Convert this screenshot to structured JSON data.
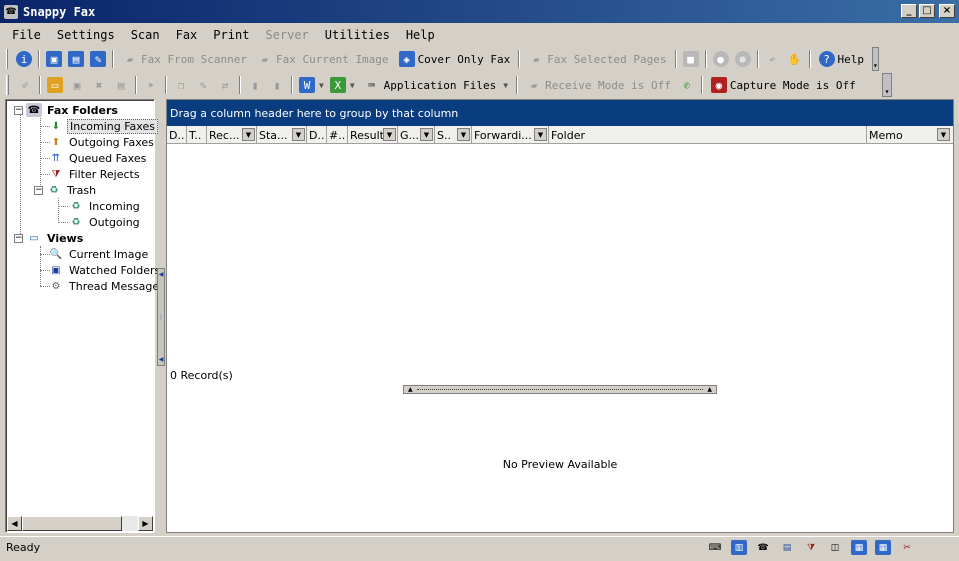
{
  "window": {
    "title": "Snappy Fax",
    "minimize": "_",
    "maximize": "□",
    "close": "×"
  },
  "menu": [
    {
      "label": "File",
      "disabled": false
    },
    {
      "label": "Settings",
      "disabled": false
    },
    {
      "label": "Scan",
      "disabled": false
    },
    {
      "label": "Fax",
      "disabled": false
    },
    {
      "label": "Print",
      "disabled": false
    },
    {
      "label": "Server",
      "disabled": true
    },
    {
      "label": "Utilities",
      "disabled": false
    },
    {
      "label": "Help",
      "disabled": false
    }
  ],
  "toolbar1": {
    "fax_from_scanner": "Fax From Scanner",
    "fax_current_image": "Fax Current Image",
    "cover_only_fax": "Cover Only Fax",
    "fax_selected_pages": "Fax Selected Pages",
    "help": "Help"
  },
  "toolbar2": {
    "application_files": "Application Files",
    "receive_mode": "Receive Mode is Off",
    "capture_mode": "Capture Mode is Off"
  },
  "tree": {
    "fax_folders": "Fax Folders",
    "incoming_faxes": "Incoming Faxes",
    "outgoing_faxes": "Outgoing Faxes",
    "queued_faxes": "Queued Faxes",
    "filter_rejects": "Filter Rejects",
    "trash": "Trash",
    "trash_incoming": "Incoming",
    "trash_outgoing": "Outgoing",
    "views": "Views",
    "current_image": "Current Image",
    "watched_folders": "Watched Folders",
    "thread_messages": "Thread Messages"
  },
  "grid": {
    "group_hint": "Drag a column header here to group by that column",
    "columns": [
      "D..",
      "T..",
      "Rec...",
      "Sta...",
      "D..",
      "#..",
      "Result",
      "G...",
      "S..",
      "Forwardi...",
      "Folder",
      "Memo"
    ],
    "records": "0 Record(s)",
    "preview": "No Preview Available"
  },
  "status": {
    "text": "Ready"
  }
}
